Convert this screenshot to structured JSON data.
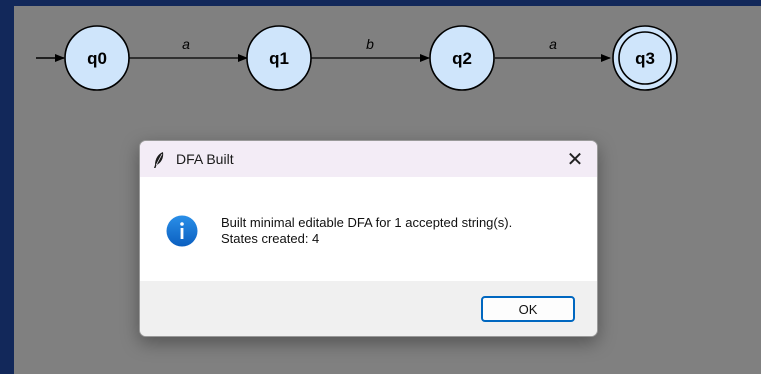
{
  "dfa": {
    "states": [
      {
        "label": "q0",
        "accepting": false
      },
      {
        "label": "q1",
        "accepting": false
      },
      {
        "label": "q2",
        "accepting": false
      },
      {
        "label": "q3",
        "accepting": true
      }
    ],
    "transitions": [
      {
        "from": "q0",
        "to": "q1",
        "symbol": "a"
      },
      {
        "from": "q1",
        "to": "q2",
        "symbol": "b"
      },
      {
        "from": "q2",
        "to": "q3",
        "symbol": "a"
      }
    ],
    "start_state": "q0",
    "colors": {
      "state_fill": "#cfe5fb",
      "canvas": "#808080",
      "background": "#12285a"
    }
  },
  "dialog": {
    "title": "DFA Built",
    "message_line1": "Built minimal editable DFA for 1 accepted string(s).",
    "message_line2": "States created: 4",
    "ok_label": "OK",
    "close_glyph": "✕",
    "icons": {
      "title": "feather-icon",
      "message": "info-icon"
    }
  }
}
